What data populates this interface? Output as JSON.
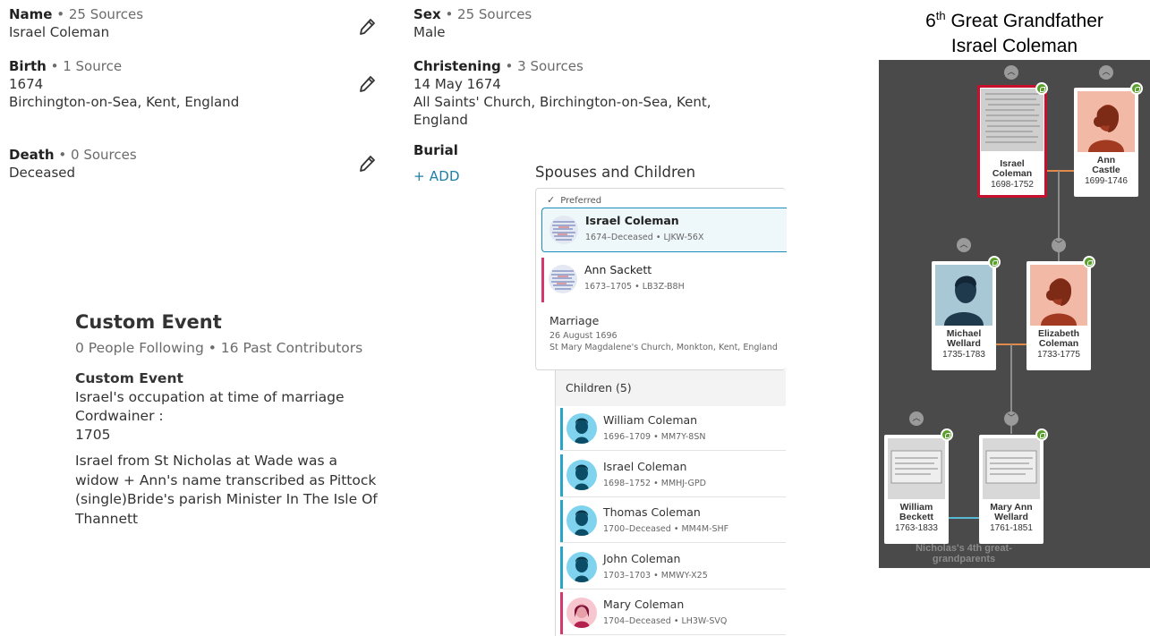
{
  "vitals": {
    "name": {
      "label": "Name",
      "sources": "• 25 Sources",
      "value": "Israel Coleman"
    },
    "birth": {
      "label": "Birth",
      "sources": "• 1 Source",
      "date": "1674",
      "place": "Birchington-on-Sea, Kent, England"
    },
    "death": {
      "label": "Death",
      "sources": "• 0 Sources",
      "value": "Deceased"
    },
    "sex": {
      "label": "Sex",
      "sources": "• 25 Sources",
      "value": "Male"
    },
    "christening": {
      "label": "Christening",
      "sources": "• 3 Sources",
      "date": "14 May 1674",
      "place_line1": "All Saints' Church, Birchington-on-Sea, Kent,",
      "place_line2": "England"
    },
    "burial": {
      "label": "Burial",
      "add_label": "+ ADD"
    }
  },
  "custom_event": {
    "title": "Custom Event",
    "meta": "0 People Following • 16 Past Contributors",
    "subtitle": "Custom Event",
    "line1": "Israel's occupation at time of marriage",
    "line2": "Cordwainer :",
    "line3": "1705",
    "notes": "Israel from St Nicholas at Wade was a widow + Ann's name transcribed as Pittock (single)Bride's parish Minister In The Isle Of Thannett"
  },
  "spouses": {
    "title": "Spouses and Children",
    "preferred_label": "Preferred",
    "husband": {
      "name": "Israel Coleman",
      "details": "1674–Deceased • LJKW-56X"
    },
    "wife": {
      "name": "Ann Sackett",
      "details": "1673–1705 • LB3Z-B8H"
    },
    "marriage": {
      "label": "Marriage",
      "date": "26 August 1696",
      "place": "St Mary Magdalene's Church, Monkton, Kent, England"
    },
    "children_header": "Children (5)",
    "children": [
      {
        "name": "William Coleman",
        "details": "1696–1709 • MM7Y-8SN",
        "sex": "male"
      },
      {
        "name": "Israel Coleman",
        "details": "1698–1752 • MMHJ-GPD",
        "sex": "male"
      },
      {
        "name": "Thomas Coleman",
        "details": "1700–Deceased • MM4M-SHF",
        "sex": "male"
      },
      {
        "name": "John Coleman",
        "details": "1703–1703 • MMWY-X25",
        "sex": "male"
      },
      {
        "name": "Mary Coleman",
        "details": "1704–Deceased • LH3W-SVQ",
        "sex": "female"
      }
    ]
  },
  "tree": {
    "title_ordinal": "6",
    "title_sup": "th",
    "title_rest": " Great Grandfather",
    "title_name": "Israel Coleman",
    "cards": [
      {
        "name1": "Israel",
        "name2": "Coleman",
        "years": "1698-1752",
        "photo": "document"
      },
      {
        "name1": "Ann",
        "name2": "Castle",
        "years": "1699-1746",
        "photo": "female"
      },
      {
        "name1": "Michael",
        "name2": "Wellard",
        "years": "1735-1783",
        "photo": "male"
      },
      {
        "name1": "Elizabeth",
        "name2": "Coleman",
        "years": "1733-1775",
        "photo": "female"
      },
      {
        "name1": "William",
        "name2": "Beckett",
        "years": "1763-1833",
        "photo": "document"
      },
      {
        "name1": "Mary Ann",
        "name2": "Wellard",
        "years": "1761-1851",
        "photo": "document"
      }
    ],
    "footer_note": "Nicholas's 4th great-grandparents",
    "colors": {
      "background": "#4a4a4a",
      "highlight": "#c8102e",
      "leaf": "#5aa02c"
    }
  }
}
